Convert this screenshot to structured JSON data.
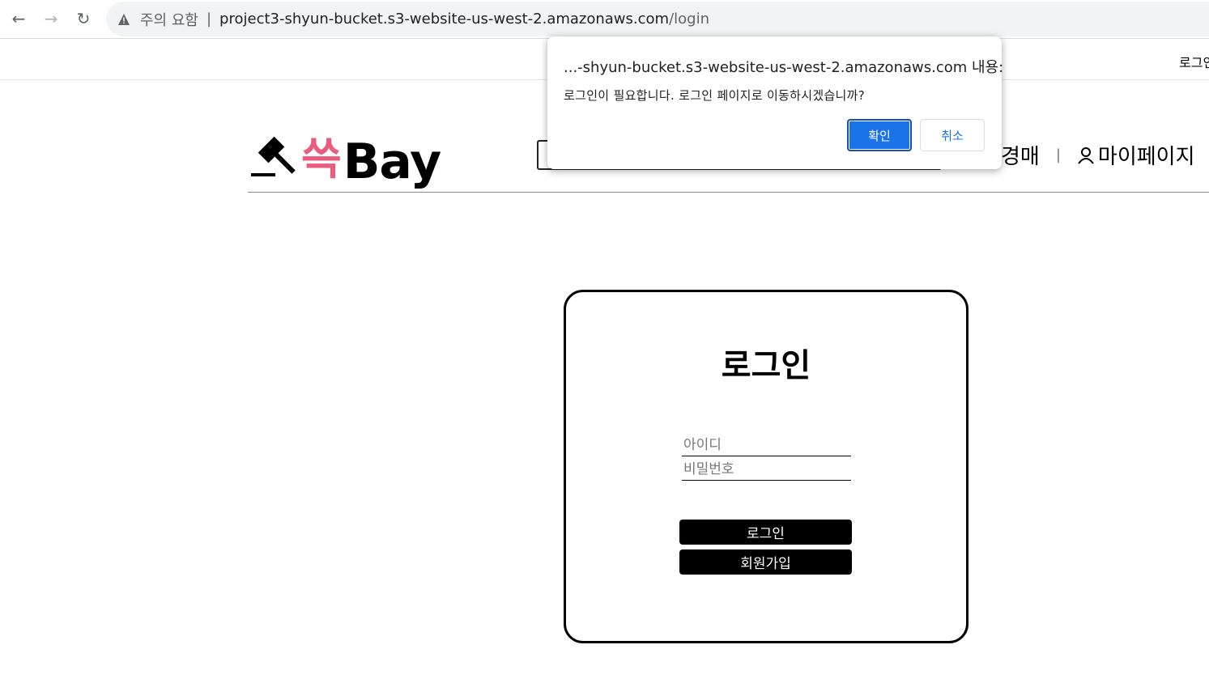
{
  "browser": {
    "security_warning": "주의 요함",
    "url_host": "project3-shyun-bucket.s3-website-us-west-2.amazonaws.com",
    "url_path": "/login",
    "separator": "|"
  },
  "util": {
    "login_link": "로그인"
  },
  "header": {
    "logo_kr": "쓱",
    "logo_en": "Bay",
    "nav_auction": "경매",
    "nav_divider": "|",
    "nav_mypage": "마이페이지"
  },
  "login_card": {
    "title": "로그인",
    "id_placeholder": "아이디",
    "pw_placeholder": "비밀번호",
    "login_button": "로그인",
    "signup_button": "회원가입"
  },
  "dialog": {
    "title": "...-shyun-bucket.s3-website-us-west-2.amazonaws.com 내용:",
    "message": "로그인이 필요합니다. 로그인 페이지로 이동하시겠습니까?",
    "ok_label": "확인",
    "cancel_label": "취소"
  },
  "colors": {
    "accent": "#1a73e8",
    "logo_pink": "#e85d7f"
  }
}
